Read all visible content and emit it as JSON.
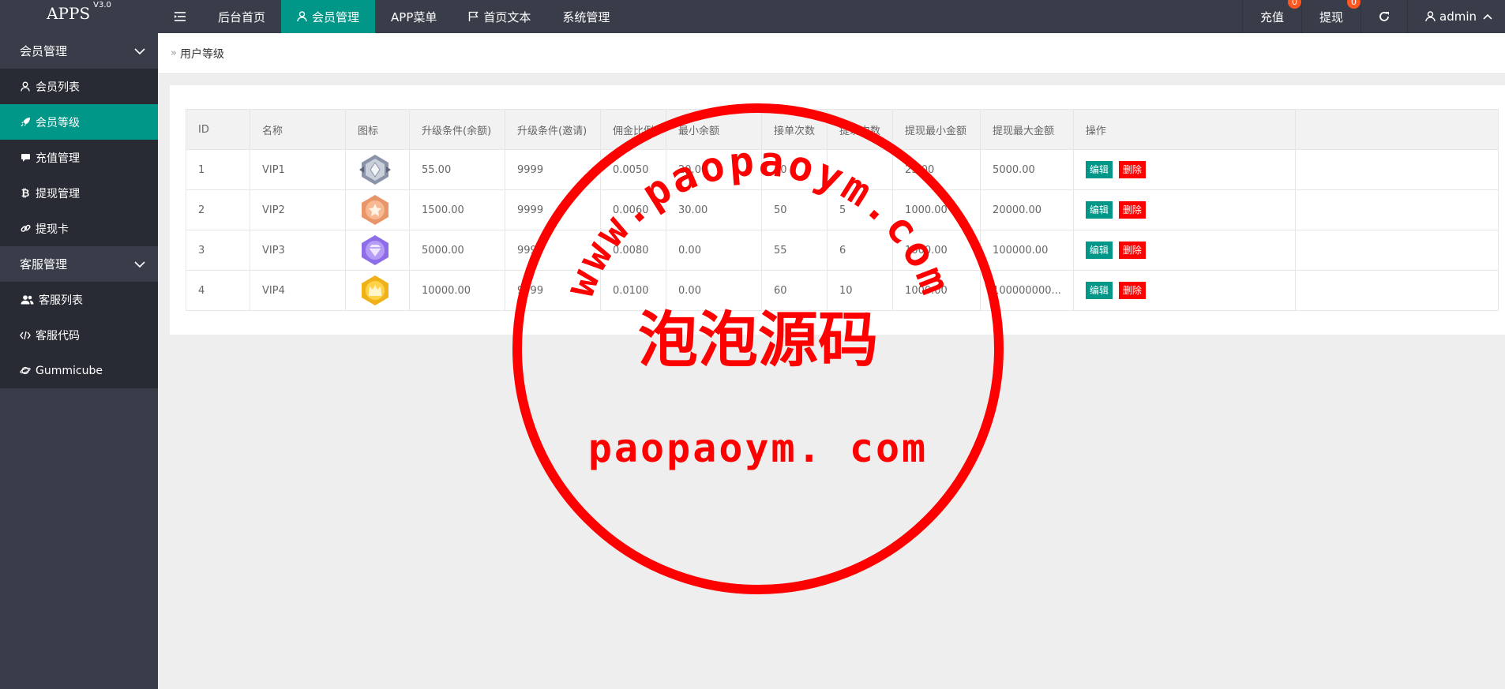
{
  "header": {
    "logo": "APPS",
    "version": "V3.0",
    "nav": [
      {
        "label": "后台首页"
      },
      {
        "label": "会员管理"
      },
      {
        "label": "APP菜单"
      },
      {
        "label": "首页文本"
      },
      {
        "label": "系统管理"
      }
    ],
    "right": {
      "recharge_label": "充值",
      "recharge_count": "0",
      "withdraw_label": "提现",
      "withdraw_count": "0",
      "user": "admin"
    }
  },
  "sidebar": {
    "group1": "会员管理",
    "items1": [
      {
        "label": "会员列表"
      },
      {
        "label": "会员等级"
      },
      {
        "label": "充值管理"
      },
      {
        "label": "提现管理"
      },
      {
        "label": "提现卡"
      }
    ],
    "group2": "客服管理",
    "items2": [
      {
        "label": "客服列表"
      },
      {
        "label": "客服代码"
      },
      {
        "label": "Gummicube"
      }
    ]
  },
  "breadcrumb": "用户等级",
  "table": {
    "headers": [
      "ID",
      "名称",
      "图标",
      "升级条件(余额)",
      "升级条件(邀请)",
      "佣金比例",
      "最小余额",
      "接单次数",
      "提现次数",
      "提现最小金额",
      "提现最大金额",
      "操作"
    ],
    "rows": [
      {
        "id": "1",
        "name": "VIP1",
        "balance": "55.00",
        "invite": "9999",
        "commission": "0.0050",
        "min_balance": "20.00",
        "orders": "40",
        "withdraw_times": "",
        "withdraw_min": "25.00",
        "withdraw_max": "5000.00"
      },
      {
        "id": "2",
        "name": "VIP2",
        "balance": "1500.00",
        "invite": "9999",
        "commission": "0.0060",
        "min_balance": "30.00",
        "orders": "50",
        "withdraw_times": "5",
        "withdraw_min": "1000.00",
        "withdraw_max": "20000.00"
      },
      {
        "id": "3",
        "name": "VIP3",
        "balance": "5000.00",
        "invite": "9999",
        "commission": "0.0080",
        "min_balance": "0.00",
        "orders": "55",
        "withdraw_times": "6",
        "withdraw_min": "1000.00",
        "withdraw_max": "100000.00"
      },
      {
        "id": "4",
        "name": "VIP4",
        "balance": "10000.00",
        "invite": "9999",
        "commission": "0.0100",
        "min_balance": "0.00",
        "orders": "60",
        "withdraw_times": "10",
        "withdraw_min": "1000.00",
        "withdraw_max": "100000000..."
      }
    ],
    "edit_label": "编辑",
    "delete_label": "删除"
  },
  "stamp": {
    "arc_text": "www.paopaoym.com",
    "center_text": "泡泡源码",
    "bottom_text": "paopaoym. com"
  },
  "colors": {
    "header_bg": "#393d49",
    "accent": "#009688",
    "danger": "#ff0000",
    "badge": "#ff5722",
    "stamp": "#ff0000"
  }
}
